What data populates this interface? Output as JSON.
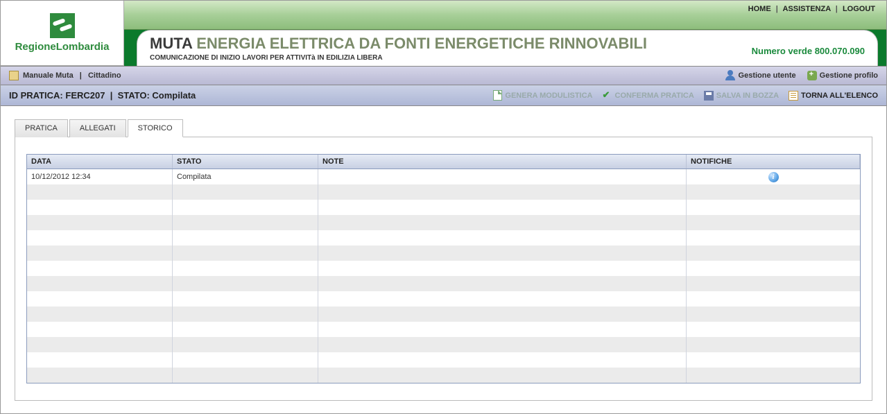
{
  "top_nav": {
    "home": "HOME",
    "assist": "ASSISTENZA",
    "logout": "LOGOUT"
  },
  "logo": {
    "text": "RegioneLombardia"
  },
  "title": {
    "main": "MUTA",
    "sub": "ENERGIA ELETTRICA DA FONTI ENERGETICHE RINNOVABILI",
    "subtitle": "COMUNICAZIONE DI INIZIO LAVORI PER ATTIVITà IN EDILIZIA LIBERA",
    "green_number_label": "Numero verde",
    "green_number": "800.070.090"
  },
  "purplebar": {
    "manual": "Manuale Muta",
    "role": "Cittadino",
    "gestione_utente": "Gestione utente",
    "gestione_profilo": "Gestione profilo"
  },
  "status": {
    "prefix_id": "ID PRATICA:",
    "id_value": "FERC207",
    "prefix_stato": "STATO:",
    "stato_value": "Compilata",
    "actions": {
      "genera": "GENERA MODULISTICA",
      "conferma": "CONFERMA PRATICA",
      "salva": "SALVA IN BOZZA",
      "torna": "TORNA ALL'ELENCO"
    }
  },
  "tabs": {
    "pratica": "PRATICA",
    "allegati": "ALLEGATI",
    "storico": "STORICO"
  },
  "grid": {
    "headers": {
      "data": "DATA",
      "stato": "STATO",
      "note": "NOTE",
      "notifiche": "NOTIFICHE"
    },
    "rows": [
      {
        "data": "10/12/2012 12:34",
        "stato": "Compilata",
        "note": "",
        "has_info": true
      }
    ],
    "empty_rows": 13
  }
}
